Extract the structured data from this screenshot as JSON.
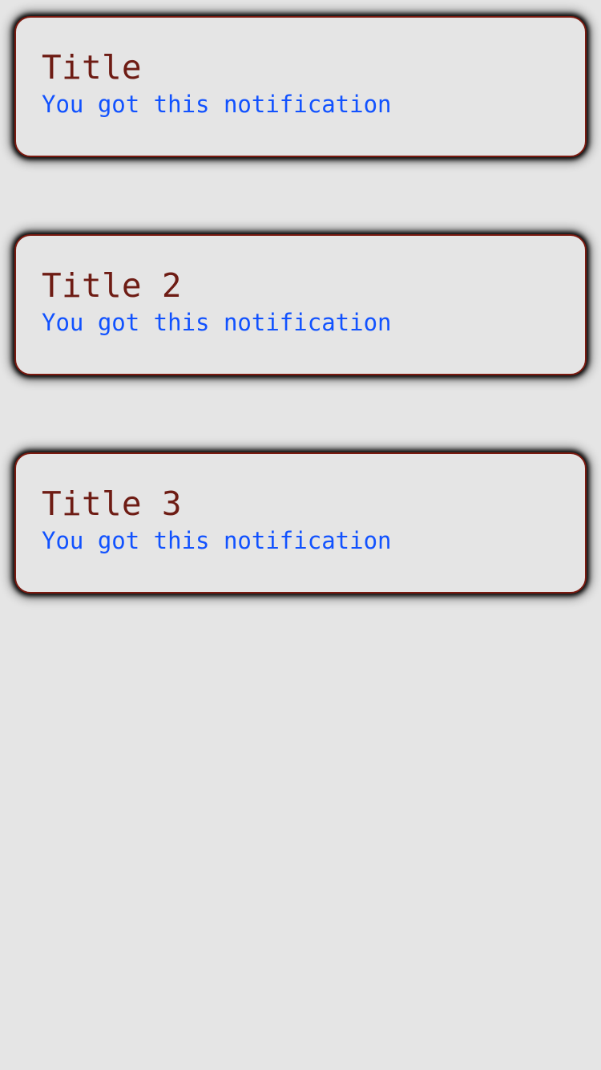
{
  "colors": {
    "background": "#e5e5e5",
    "card_border": "#7a1a10",
    "title_text": "#6e1c14",
    "body_text": "#1152ff"
  },
  "notifications": [
    {
      "title": "Title",
      "body": "You got this notification"
    },
    {
      "title": "Title 2",
      "body": "You got this notification"
    },
    {
      "title": "Title 3",
      "body": "You got this notification"
    }
  ]
}
